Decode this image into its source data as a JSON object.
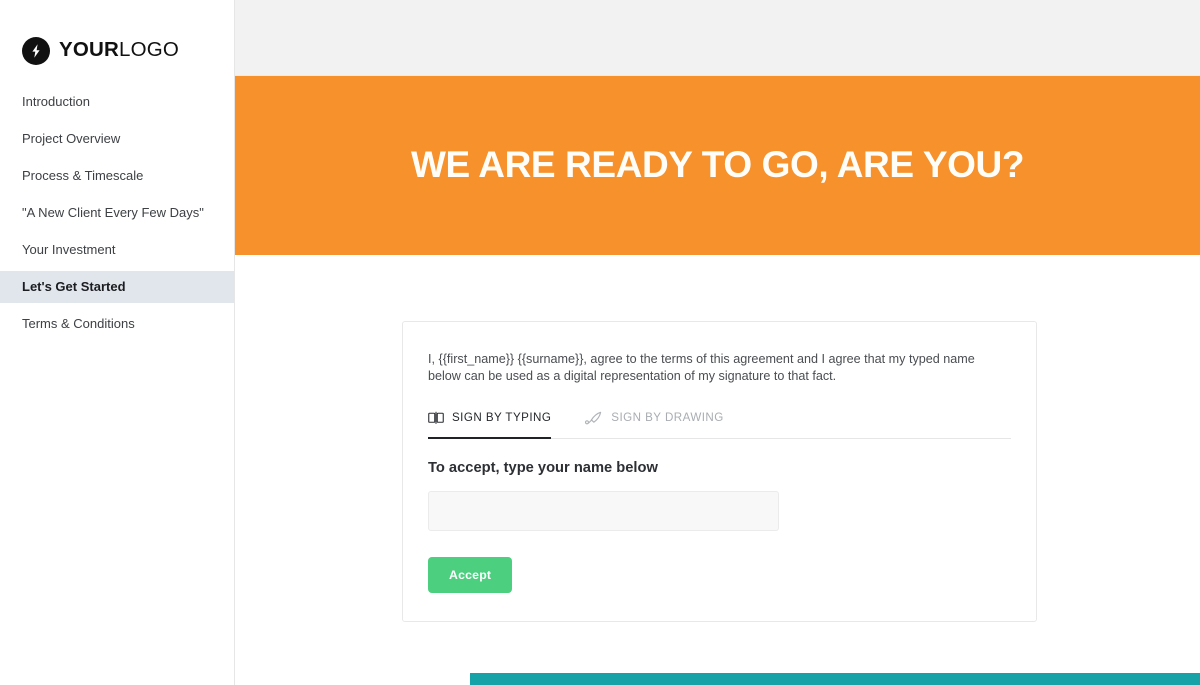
{
  "brand": {
    "logo_icon": "lightning-bolt-icon",
    "name_bold": "YOUR",
    "name_light": "LOGO"
  },
  "sidebar": {
    "items": [
      {
        "label": "Introduction",
        "active": false
      },
      {
        "label": "Project Overview",
        "active": false
      },
      {
        "label": "Process & Timescale",
        "active": false
      },
      {
        "label": "\"A New Client Every Few Days\"",
        "active": false
      },
      {
        "label": "Your Investment",
        "active": false
      },
      {
        "label": "Let's Get Started",
        "active": true
      },
      {
        "label": "Terms & Conditions",
        "active": false
      }
    ]
  },
  "hero": {
    "title": "WE ARE READY TO GO, ARE YOU?",
    "background_color": "#f6912c"
  },
  "signature_card": {
    "agreement_text": "I, {{first_name}} {{surname}}, agree to the terms of this agreement and I agree that my typed name below can be used as a digital representation of my signature to that fact.",
    "tabs": [
      {
        "label": "SIGN BY TYPING",
        "icon": "keyboard-icon",
        "active": true
      },
      {
        "label": "SIGN BY DRAWING",
        "icon": "quill-pen-icon",
        "active": false
      }
    ],
    "section_label": "To accept, type your name below",
    "name_input": {
      "value": "",
      "placeholder": ""
    },
    "accept_label": "Accept",
    "accept_color": "#4ccf7f"
  },
  "footer": {
    "band_color": "#17a2a8"
  }
}
